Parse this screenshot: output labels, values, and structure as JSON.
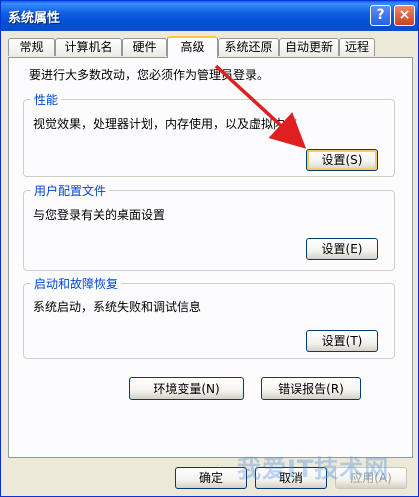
{
  "window": {
    "title": "系统属性"
  },
  "title_buttons": {
    "help": "?",
    "close": "×"
  },
  "tabs": [
    {
      "label": "常规"
    },
    {
      "label": "计算机名"
    },
    {
      "label": "硬件"
    },
    {
      "label": "高级",
      "active": true
    },
    {
      "label": "系统还原"
    },
    {
      "label": "自动更新"
    },
    {
      "label": "远程"
    }
  ],
  "intro_text": "要进行大多数改动，您必须作为管理员登录。",
  "groups": {
    "performance": {
      "title": "性能",
      "description": "视觉效果，处理器计划，内存使用，以及虚拟内存",
      "button": "设置(S)"
    },
    "profiles": {
      "title": "用户配置文件",
      "description": "与您登录有关的桌面设置",
      "button": "设置(E)"
    },
    "startup": {
      "title": "启动和故障恢复",
      "description": "系统启动，系统失败和调试信息",
      "button": "设置(T)"
    }
  },
  "buttons": {
    "env_vars": "环境变量(N)",
    "error_report": "错误报告(R)",
    "ok": "确定",
    "cancel": "取消",
    "apply": "应用(A)"
  },
  "watermark": "我爱IT技术网",
  "colors": {
    "titlebar": "#0054e3",
    "dialog_bg": "#ece9d8",
    "group_title": "#0046d5",
    "annotation_arrow": "#e02020"
  }
}
